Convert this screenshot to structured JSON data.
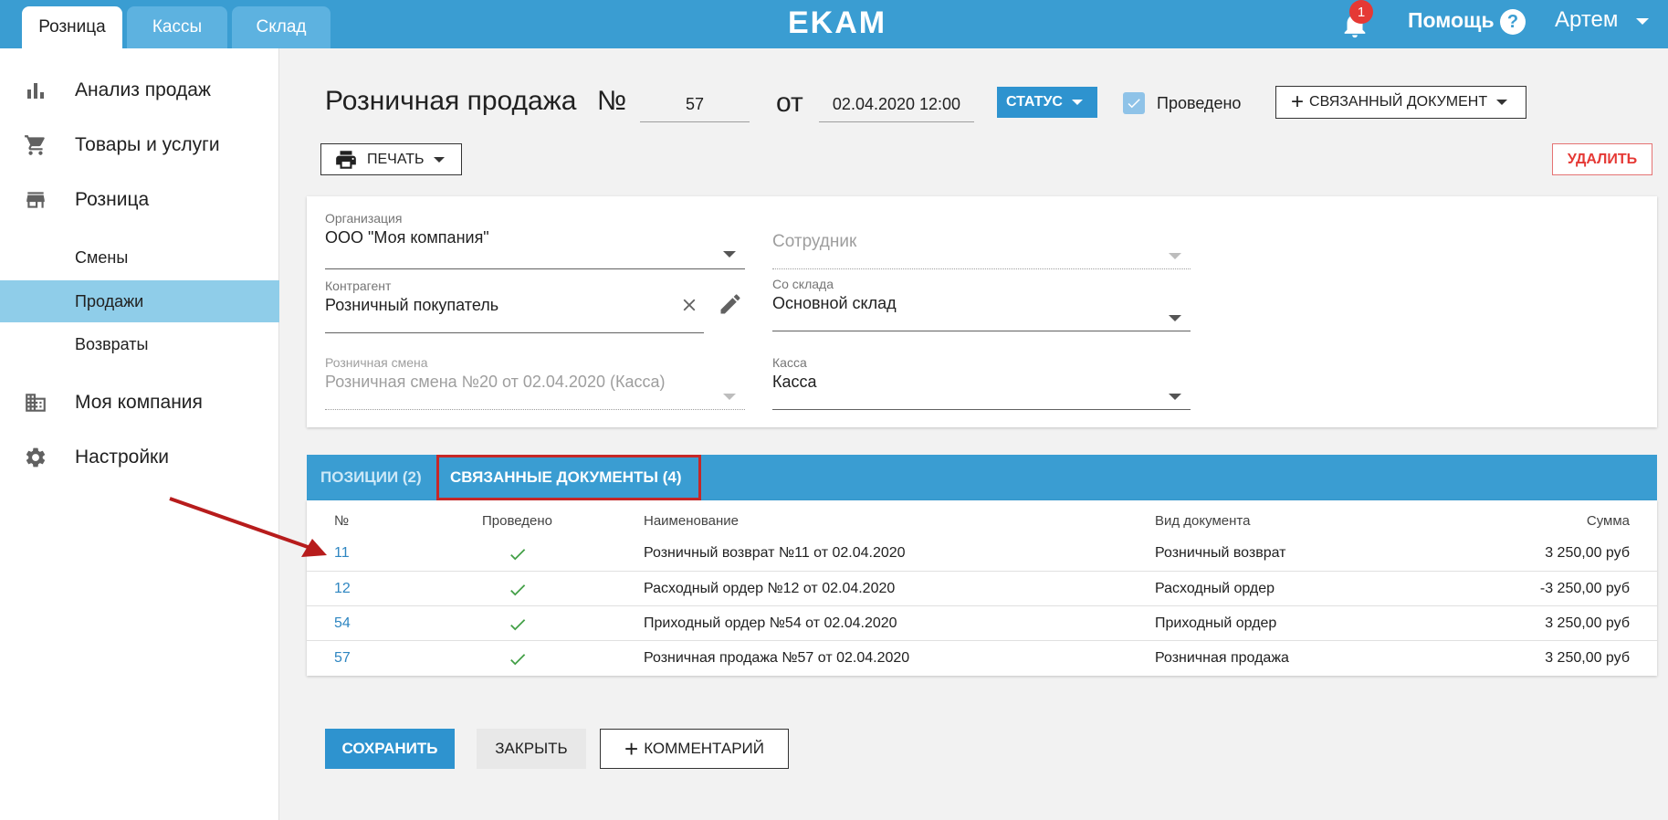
{
  "topbar": {
    "tabs": [
      "Розница",
      "Кассы",
      "Склад"
    ],
    "logo": "EKAM",
    "notifications": "1",
    "help": "Помощь",
    "help_icon": "?",
    "user": "Артем"
  },
  "sidebar": {
    "items": [
      {
        "label": "Анализ продаж",
        "icon": "bar-chart-icon"
      },
      {
        "label": "Товары и услуги",
        "icon": "cart-icon"
      },
      {
        "label": "Розница",
        "icon": "store-icon"
      },
      {
        "label": "Моя компания",
        "icon": "building-icon"
      },
      {
        "label": "Настройки",
        "icon": "gear-icon"
      }
    ],
    "sub_items": [
      "Смены",
      "Продажи",
      "Возвраты"
    ]
  },
  "header": {
    "title": "Розничная продажа",
    "number_sign": "№",
    "number": "57",
    "from": "от",
    "date": "02.04.2020 12:00",
    "status": "СТАТУС",
    "posted": "Проведено",
    "linked_doc": "СВЯЗАННЫЙ ДОКУМЕНТ",
    "print": "ПЕЧАТЬ",
    "delete": "УДАЛИТЬ"
  },
  "form": {
    "org_label": "Организация",
    "org_value": "ООО \"Моя компания\"",
    "employee_placeholder": "Сотрудник",
    "counterparty_label": "Контрагент",
    "counterparty_value": "Розничный покупатель",
    "warehouse_label": "Со склада",
    "warehouse_value": "Основной склад",
    "shift_label": "Розничная смена",
    "shift_value": "Розничная смена №20 от 02.04.2020 (Касса)",
    "cashbox_label": "Касса",
    "cashbox_value": "Касса"
  },
  "tabs": {
    "positions": "ПОЗИЦИИ (2)",
    "linked": "СВЯЗАННЫЕ ДОКУМЕНТЫ (4)"
  },
  "table": {
    "headers": [
      "№",
      "Проведено",
      "Наименование",
      "Вид документа",
      "Сумма"
    ],
    "rows": [
      {
        "num": "11",
        "name": "Розничный возврат №11 от 02.04.2020",
        "type": "Розничный возврат",
        "sum": "3 250,00 руб"
      },
      {
        "num": "12",
        "name": "Расходный ордер №12 от 02.04.2020",
        "type": "Расходный ордер",
        "sum": "-3 250,00 руб"
      },
      {
        "num": "54",
        "name": "Приходный ордер №54 от 02.04.2020",
        "type": "Приходный ордер",
        "sum": "3 250,00 руб"
      },
      {
        "num": "57",
        "name": "Розничная продажа №57 от 02.04.2020",
        "type": "Розничная продажа",
        "sum": "3 250,00 руб"
      }
    ]
  },
  "footer": {
    "save": "СОХРАНИТЬ",
    "close": "ЗАКРЫТЬ",
    "comment": "КОММЕНТАРИЙ"
  },
  "colors": {
    "primary": "#3a9dd2",
    "selected": "#8fcde9",
    "danger": "#e53935",
    "check": "#43a047",
    "highlight": "#c62828"
  }
}
